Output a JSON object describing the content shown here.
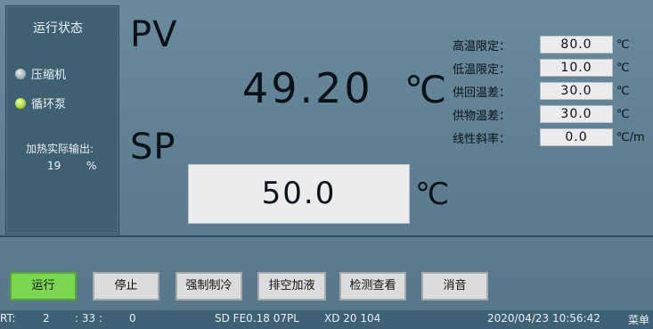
{
  "status_panel": {
    "title": "运行状态",
    "indicators": [
      {
        "label": "压缩机",
        "state": "off"
      },
      {
        "label": "循环泵",
        "state": "on"
      }
    ],
    "heat_output_label": "加热实际输出:",
    "heat_output_value": "19",
    "heat_output_unit": "%"
  },
  "pv": {
    "label": "PV",
    "value": "49.20",
    "unit": "℃"
  },
  "sp": {
    "label": "SP",
    "value": "50.0",
    "unit": "℃"
  },
  "settings": [
    {
      "label": "高温限定：",
      "value": "80.0",
      "unit": "℃"
    },
    {
      "label": "低温限定：",
      "value": "10.0",
      "unit": "℃"
    },
    {
      "label": "供回温差：",
      "value": "30.0",
      "unit": "℃"
    },
    {
      "label": "供物温差：",
      "value": "30.0",
      "unit": "℃"
    },
    {
      "label": "线性斜率：",
      "value": "0.0",
      "unit": "℃/m"
    }
  ],
  "buttons": {
    "run": "运行",
    "stop": "停止",
    "force_cool": "强制制冷",
    "drain_fill": "排空加液",
    "inspect": "检测查看",
    "mute": "消音"
  },
  "statusbar": {
    "rt_label": "RT:",
    "rt_h": "2",
    "rt_m": ": 33 :",
    "rt_s": "0",
    "sd": "SD FE0.18 07PL",
    "xd": "XD 20  104",
    "datetime": "2020/04/23 10:56:42",
    "menu": "菜单"
  },
  "colors": {
    "run_button": "#7bd84e",
    "pump_on": "#a6d82b",
    "screen_bg": "#5f7e91"
  }
}
